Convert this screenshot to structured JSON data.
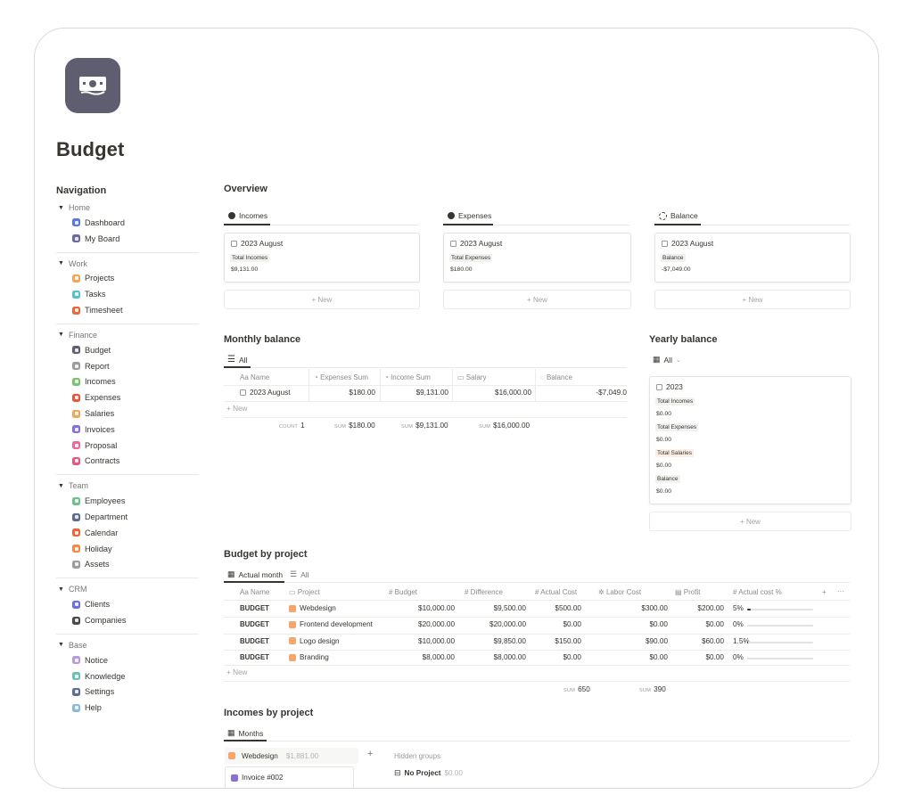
{
  "page": {
    "title": "Budget",
    "icon": "money-icon"
  },
  "nav": {
    "title": "Navigation",
    "groups": [
      {
        "label": "Home",
        "items": [
          {
            "label": "Dashboard",
            "icon": "dashboard-icon",
            "color": "#5b7bd5"
          },
          {
            "label": "My Board",
            "icon": "user-board-icon",
            "color": "#6b6aa8"
          }
        ]
      },
      {
        "label": "Work",
        "items": [
          {
            "label": "Projects",
            "icon": "projects-icon",
            "color": "#f2a65a"
          },
          {
            "label": "Tasks",
            "icon": "tasks-icon",
            "color": "#5bc0c9"
          },
          {
            "label": "Timesheet",
            "icon": "timesheet-icon",
            "color": "#e9673e"
          }
        ]
      },
      {
        "label": "Finance",
        "items": [
          {
            "label": "Budget",
            "icon": "budget-icon",
            "color": "#5f5d70"
          },
          {
            "label": "Report",
            "icon": "report-icon",
            "color": "#9c9c9c"
          },
          {
            "label": "Incomes",
            "icon": "incomes-icon",
            "color": "#7cc36e"
          },
          {
            "label": "Expenses",
            "icon": "expenses-icon",
            "color": "#e9573e"
          },
          {
            "label": "Salaries",
            "icon": "salaries-icon",
            "color": "#f2a65a"
          },
          {
            "label": "Invoices",
            "icon": "invoices-icon",
            "color": "#8a6fd8"
          },
          {
            "label": "Proposal",
            "icon": "proposal-icon",
            "color": "#e86aa0"
          },
          {
            "label": "Contracts",
            "icon": "contracts-icon",
            "color": "#e8577d"
          }
        ]
      },
      {
        "label": "Team",
        "items": [
          {
            "label": "Employees",
            "icon": "employees-icon",
            "color": "#6cc08b"
          },
          {
            "label": "Department",
            "icon": "department-icon",
            "color": "#5f6b8f"
          },
          {
            "label": "Calendar",
            "icon": "calendar-icon",
            "color": "#e9673e"
          },
          {
            "label": "Holiday",
            "icon": "holiday-icon",
            "color": "#f28a4a"
          },
          {
            "label": "Assets",
            "icon": "assets-icon",
            "color": "#9c9c9c"
          }
        ]
      },
      {
        "label": "CRM",
        "items": [
          {
            "label": "Clients",
            "icon": "clients-icon",
            "color": "#6b72d8"
          },
          {
            "label": "Companies",
            "icon": "companies-icon",
            "color": "#4a4a4a"
          }
        ]
      },
      {
        "label": "Base",
        "items": [
          {
            "label": "Notice",
            "icon": "notice-icon",
            "color": "#b59ce0"
          },
          {
            "label": "Knowledge",
            "icon": "knowledge-icon",
            "color": "#6cc0b5"
          },
          {
            "label": "Settings",
            "icon": "settings-icon",
            "color": "#5f6b8f"
          },
          {
            "label": "Help",
            "icon": "help-icon",
            "color": "#8fb8e0"
          }
        ]
      }
    ]
  },
  "overview": {
    "title": "Overview",
    "columns": [
      {
        "tab": "Incomes",
        "card_title": "2023 August",
        "label": "Total Incomes",
        "value": "$9,131.00",
        "new": "New"
      },
      {
        "tab": "Expenses",
        "card_title": "2023 August",
        "label": "Total Expenses",
        "value": "$180.00",
        "new": "New"
      },
      {
        "tab": "Balance",
        "card_title": "2023 August",
        "label": "Balance",
        "value": "-$7,049.00",
        "new": "New"
      }
    ]
  },
  "monthly": {
    "title": "Monthly balance",
    "tab": "All",
    "headers": [
      "Name",
      "Expenses Sum",
      "Income Sum",
      "Salary",
      "Balance"
    ],
    "row": {
      "name": "2023 August",
      "expenses": "$180.00",
      "income": "$9,131.00",
      "salary": "$16,000.00",
      "balance": "-$7,049.0"
    },
    "new": "New",
    "footer": {
      "count_label": "COUNT",
      "count": "1",
      "sum_label": "SUM",
      "expenses": "$180.00",
      "income": "$9,131.00",
      "salary": "$16,000.00"
    }
  },
  "yearly": {
    "title": "Yearly balance",
    "tab": "All",
    "card_title": "2023",
    "fields": [
      {
        "label": "Total Incomes",
        "value": "$0.00"
      },
      {
        "label": "Total Expenses",
        "value": "$0.00"
      },
      {
        "label": "Total Salaries",
        "value": "$0.00"
      },
      {
        "label": "Balance",
        "value": "$0.00"
      }
    ],
    "new": "New"
  },
  "by_project": {
    "title": "Budget by project",
    "tabs": [
      "Actual month",
      "All"
    ],
    "headers": [
      "Name",
      "Project",
      "Budget",
      "Difference",
      "Actual Cost",
      "Labor Cost",
      "Profit",
      "Actual cost %"
    ],
    "rows": [
      {
        "name": "BUDGET",
        "project": "Webdesign",
        "budget": "$10,000.00",
        "difference": "$9,500.00",
        "actual": "$500.00",
        "labor": "$300.00",
        "profit": "$200.00",
        "pct": "5%",
        "pct_value": 0.05
      },
      {
        "name": "BUDGET",
        "project": "Frontend development",
        "budget": "$20,000.00",
        "difference": "$20,000.00",
        "actual": "$0.00",
        "labor": "$0.00",
        "profit": "$0.00",
        "pct": "0%",
        "pct_value": 0
      },
      {
        "name": "BUDGET",
        "project": "Logo design",
        "budget": "$10,000.00",
        "difference": "$9,850.00",
        "actual": "$150.00",
        "labor": "$90.00",
        "profit": "$60.00",
        "pct": "1.5%",
        "pct_value": 0.015
      },
      {
        "name": "BUDGET",
        "project": "Branding",
        "budget": "$8,000.00",
        "difference": "$8,000.00",
        "actual": "$0.00",
        "labor": "$0.00",
        "profit": "$0.00",
        "pct": "0%",
        "pct_value": 0
      }
    ],
    "new": "New",
    "footer": {
      "sum_label": "SUM",
      "actual": "650",
      "labor": "390"
    }
  },
  "incomes_by_project": {
    "title": "Incomes by project",
    "tab": "Months",
    "group": {
      "label": "Webdesign",
      "amount": "$1,881.00",
      "item": "Invoice #002"
    },
    "hidden_groups": "Hidden groups",
    "no_project": {
      "label": "No Project",
      "amount": "$0.00"
    }
  }
}
